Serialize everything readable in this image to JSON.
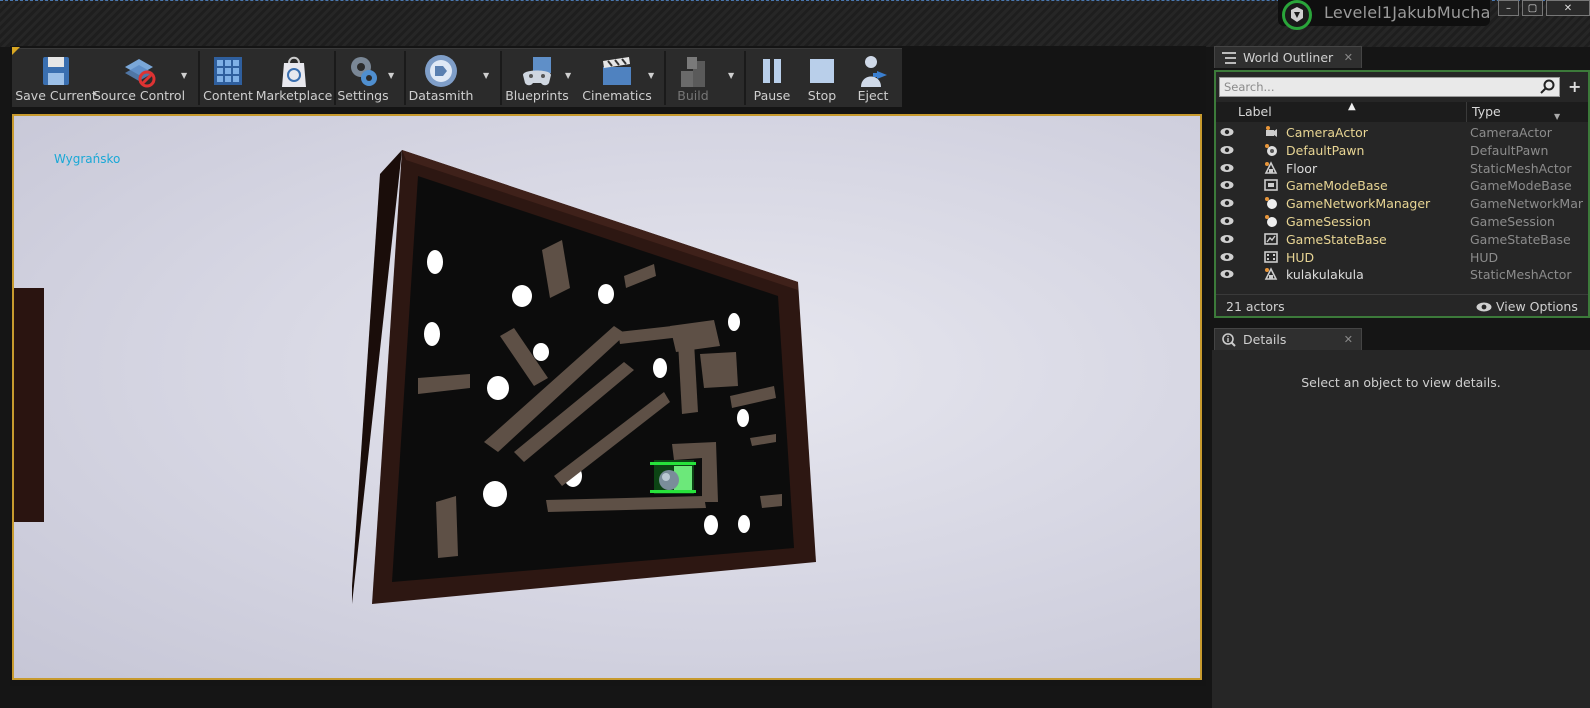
{
  "window": {
    "project_name": "Levelel1JakubMucha",
    "controls": [
      "minimize",
      "maximize",
      "close"
    ]
  },
  "toolbar": {
    "buttons": [
      {
        "label": "Save Current",
        "icon": "save-icon",
        "dropdown": false,
        "enabled": true
      },
      {
        "label": "Source Control",
        "icon": "source-control-icon",
        "dropdown": true,
        "enabled": true
      },
      {
        "label": "Content",
        "icon": "content-icon",
        "dropdown": false,
        "enabled": true
      },
      {
        "label": "Marketplace",
        "icon": "marketplace-icon",
        "dropdown": false,
        "enabled": true
      },
      {
        "label": "Settings",
        "icon": "settings-icon",
        "dropdown": true,
        "enabled": true
      },
      {
        "label": "Datasmith",
        "icon": "datasmith-icon",
        "dropdown": true,
        "enabled": true
      },
      {
        "label": "Blueprints",
        "icon": "blueprints-icon",
        "dropdown": true,
        "enabled": true
      },
      {
        "label": "Cinematics",
        "icon": "cinematics-icon",
        "dropdown": true,
        "enabled": true
      },
      {
        "label": "Build",
        "icon": "build-icon",
        "dropdown": true,
        "enabled": false
      },
      {
        "label": "Pause",
        "icon": "pause-icon",
        "dropdown": false,
        "enabled": true
      },
      {
        "label": "Stop",
        "icon": "stop-icon",
        "dropdown": false,
        "enabled": true
      },
      {
        "label": "Eject",
        "icon": "eject-icon",
        "dropdown": false,
        "enabled": true
      }
    ]
  },
  "viewport": {
    "overlay_text": "Wygrańsko"
  },
  "world_outliner": {
    "tab_title": "World Outliner",
    "search_placeholder": "Search...",
    "columns": {
      "label": "Label",
      "type": "Type"
    },
    "rows": [
      {
        "label": "CameraActor",
        "type": "CameraActor",
        "icon": "camera-actor-icon",
        "highlight": true
      },
      {
        "label": "DefaultPawn",
        "type": "DefaultPawn",
        "icon": "pawn-icon",
        "highlight": true
      },
      {
        "label": "Floor",
        "type": "StaticMeshActor",
        "icon": "static-mesh-icon",
        "highlight": false
      },
      {
        "label": "GameModeBase",
        "type": "GameModeBase",
        "icon": "game-mode-icon",
        "highlight": true
      },
      {
        "label": "GameNetworkManager",
        "type": "GameNetworkMar",
        "icon": "network-manager-icon",
        "highlight": true
      },
      {
        "label": "GameSession",
        "type": "GameSession",
        "icon": "game-session-icon",
        "highlight": true
      },
      {
        "label": "GameStateBase",
        "type": "GameStateBase",
        "icon": "game-state-icon",
        "highlight": true
      },
      {
        "label": "HUD",
        "type": "HUD",
        "icon": "hud-icon",
        "highlight": true
      },
      {
        "label": "kulakulakula",
        "type": "StaticMeshActor",
        "icon": "static-mesh-icon",
        "highlight": false
      }
    ],
    "actor_count": "21 actors",
    "view_options_label": "View Options"
  },
  "details": {
    "tab_title": "Details",
    "empty_message": "Select an object to view details."
  }
}
